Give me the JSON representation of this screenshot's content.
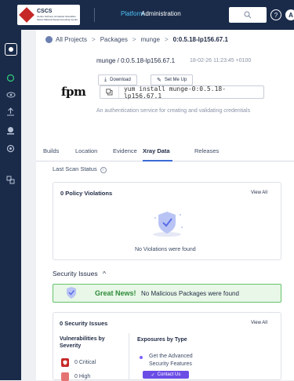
{
  "topbar": {
    "logo_title": "CSCS",
    "logo_subtitle": "Centro Svizzero di Calcolo Scientifico",
    "logo_subtitle2": "Swiss National Supercomputing Centre",
    "platform": "Platform",
    "administration": "Administration",
    "avatar_letter": "A",
    "help_label": "?"
  },
  "breadcrumb": {
    "items": [
      "All Projects",
      "Packages",
      "munge",
      "0:0.5.18-lp156.67.1"
    ],
    "separator": ">"
  },
  "package": {
    "title": "munge / 0:0.5.18-lp156.67.1",
    "date": "18-02-26 11:23:45 +0100",
    "download_label": "Download",
    "setmeup_label": "Set Me Up",
    "install_cmd": "yum install munge-0:0.5.18-lp156.67.1",
    "logo_text": "fpm",
    "description": "An authentication service for creating and validating credentials"
  },
  "tabs": [
    "Builds",
    "Location",
    "Evidence",
    "Xray Data",
    "Releases"
  ],
  "active_tab": "Xray Data",
  "scan": {
    "label": "Last Scan Status",
    "info_icon": "i"
  },
  "policy": {
    "title": "0 Policy Violations",
    "view_all": "View All",
    "empty_text": "No Violations were found"
  },
  "security": {
    "heading": "Security Issues",
    "caret": "^",
    "news_great": "Great News!",
    "news_text": "No Malicious Packages were found",
    "card_title": "0 Security Issues",
    "view_all": "View All",
    "vuln_label": "Vulnerabilities by Severity",
    "critical_label": "0 Critical",
    "high_label": "0 High",
    "exposures_label": "Exposures by Type",
    "exposures_text": "Get the Advanced Security Features",
    "contact_label": "Contact Us",
    "contact_check": "✓"
  },
  "colors": {
    "topbar": "#1a2b4a",
    "accent": "#4fc3f7",
    "success": "#64c36a",
    "critical": "#c62828",
    "purple": "#6b4de6"
  }
}
